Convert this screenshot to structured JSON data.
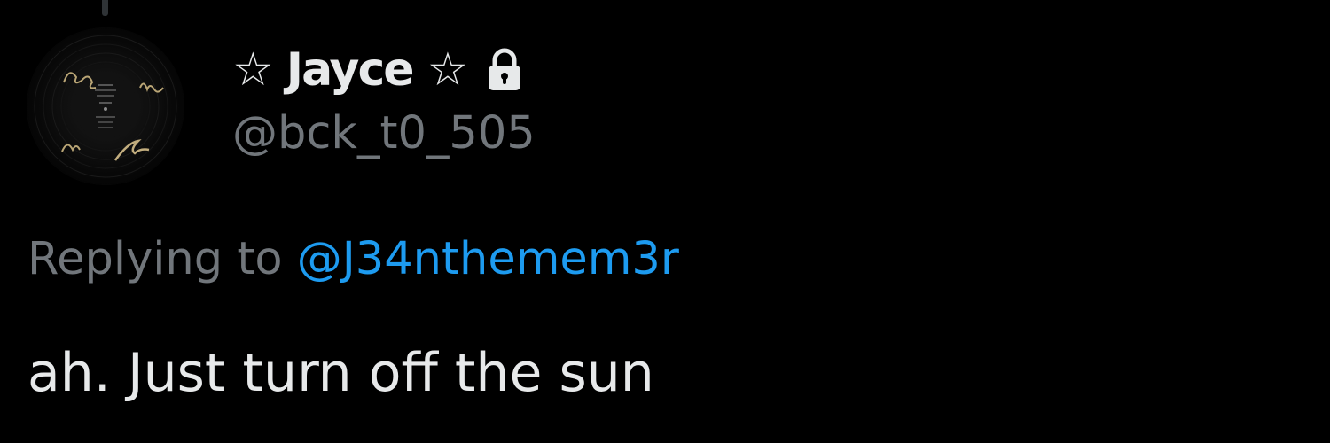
{
  "author": {
    "display_name": "☆ Jayce ☆",
    "handle": "@bck_t0_505",
    "protected_icon": "lock-icon",
    "avatar_icon": "vinyl-record-signed-avatar"
  },
  "reply": {
    "prefix": "Replying to ",
    "target": "@J34nthemem3r"
  },
  "tweet": {
    "text": "ah. Just turn off the sun"
  },
  "colors": {
    "background": "#000000",
    "primary_text": "#e7e9ea",
    "secondary_text": "#71767b",
    "link": "#1d9bf0"
  }
}
